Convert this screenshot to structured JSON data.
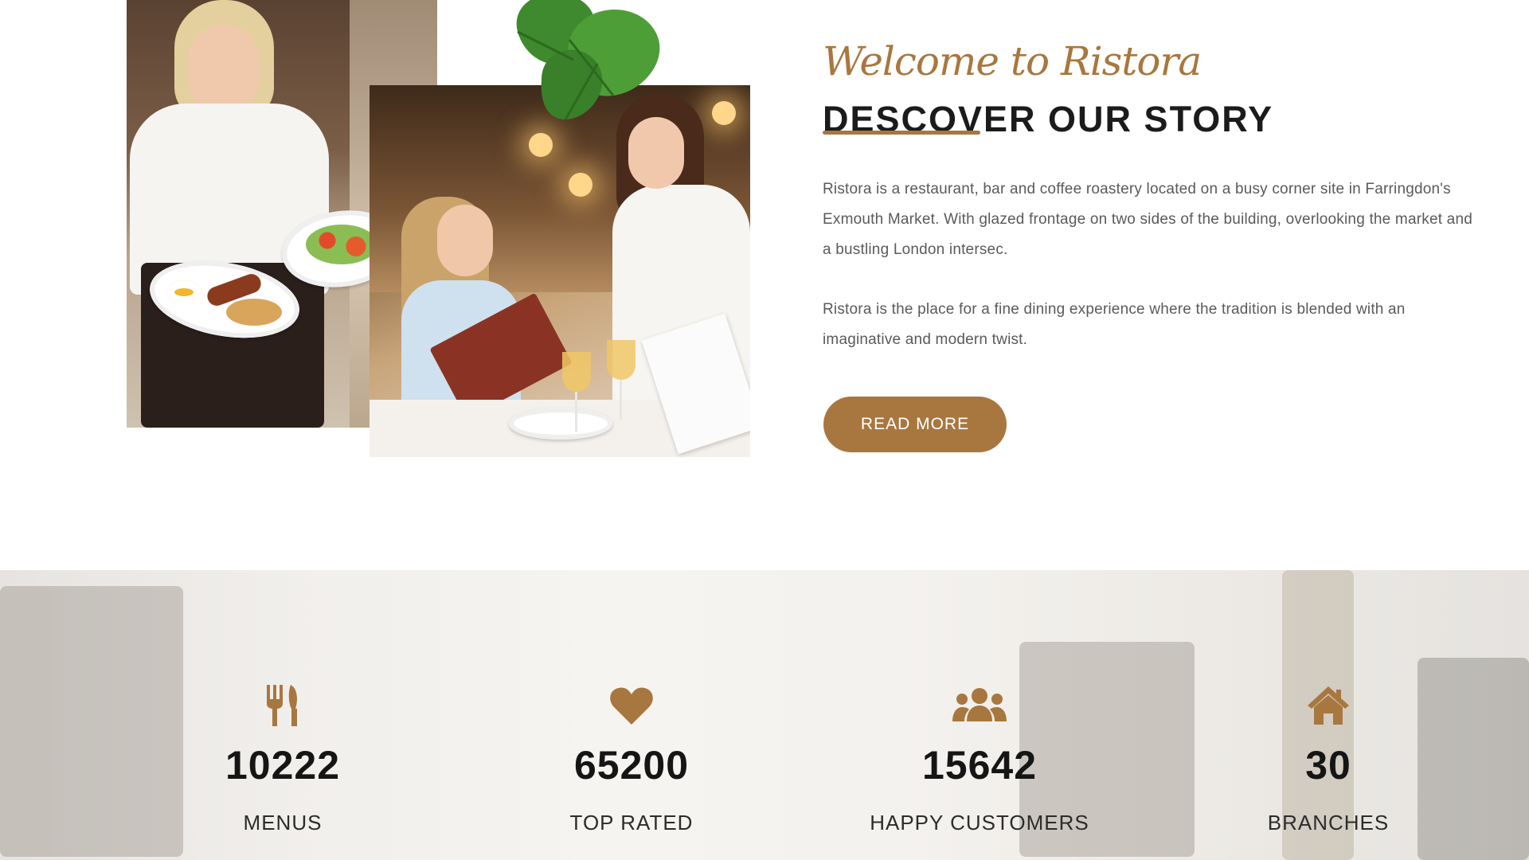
{
  "about": {
    "eyebrow": "Welcome to Ristora",
    "headline": "DESCOVER OUR STORY",
    "paragraph_1": "Ristora is a restaurant, bar and coffee roastery located on a busy corner site in Farringdon's Exmouth Market. With glazed frontage on two sides of the building, overlooking the market and a bustling London intersec.",
    "paragraph_2": "Ristora is the place for a fine dining experience where the tradition is blended with an imaginative and modern twist.",
    "button_label": "READ MORE"
  },
  "stats": [
    {
      "icon": "fork-knife-icon",
      "value": "10222",
      "label": "MENUS"
    },
    {
      "icon": "heart-icon",
      "value": "65200",
      "label": "TOP RATED"
    },
    {
      "icon": "users-icon",
      "value": "15642",
      "label": "HAPPY CUSTOMERS"
    },
    {
      "icon": "home-icon",
      "value": "30",
      "label": "BRANCHES"
    }
  ],
  "colors": {
    "accent": "#a8773f",
    "heading": "#1b1b1b",
    "body_text": "#5a5a5a",
    "background": "#ffffff"
  }
}
